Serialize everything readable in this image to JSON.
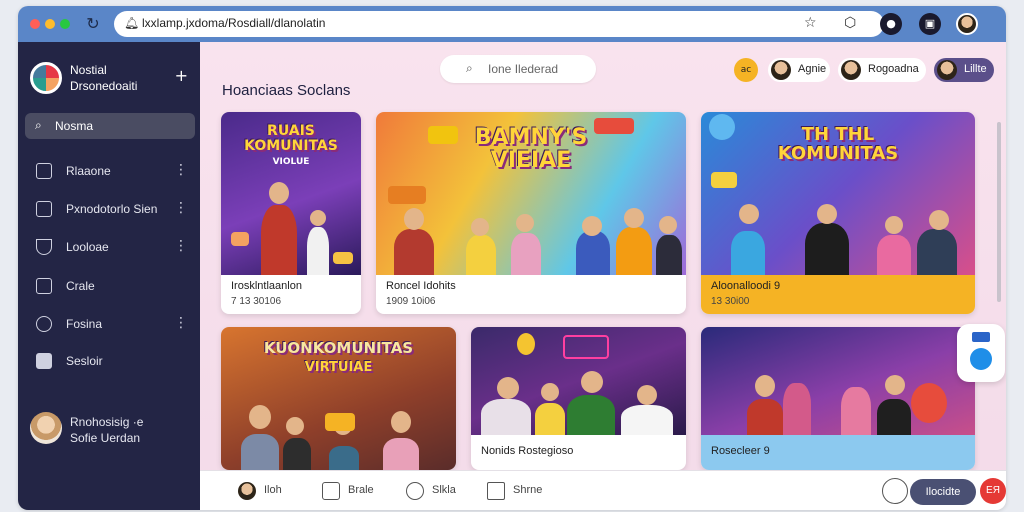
{
  "browser": {
    "url": "lxxlamp.jxdoma/Rosdiall/dlanolatin"
  },
  "sidebar": {
    "brand": {
      "line1": "Nostial",
      "line2": "Drsonedoaiti"
    },
    "search_label": "Nosma",
    "items": [
      {
        "label": "Rlaaone"
      },
      {
        "label": "Pxnodotorlo Sien"
      },
      {
        "label": "Looloae"
      },
      {
        "label": "Crale"
      },
      {
        "label": "Fosina"
      },
      {
        "label": "Sesloir"
      }
    ],
    "profile": {
      "line1": "Rnohosisig ·e",
      "line2": "Sofie Uerdan"
    }
  },
  "header": {
    "search_placeholder": "Ione Ilederad",
    "badge": "ac",
    "users": [
      {
        "label": "Agnie"
      },
      {
        "label": "Rogoadna"
      },
      {
        "label": "Lillte"
      }
    ]
  },
  "main": {
    "title": "Hoanciaas Soclans",
    "cards": [
      {
        "banner": "RUAIS KOMUNITAS",
        "banner_sub": "VIOLUE",
        "title": "Irosklntlaanlon",
        "subtitle": "7 13 30106"
      },
      {
        "banner": "BAMNY'S VIEIAE",
        "banner_sub": "",
        "title": "Roncel Idohits",
        "subtitle": "1909 10i06"
      },
      {
        "banner": "TH THL KOMUNITAS",
        "banner_sub": "",
        "title": "Aloonalloodi 9",
        "subtitle": "13 30i00"
      },
      {
        "banner": "KUONKOMUNITAS",
        "banner_sub": "VIRTUIAE",
        "title": "",
        "subtitle": ""
      },
      {
        "banner": "",
        "banner_sub": "",
        "title": "Nonids Rostegioso",
        "subtitle": ""
      },
      {
        "banner": "",
        "banner_sub": "",
        "title": "Rosecleer 9",
        "subtitle": ""
      }
    ]
  },
  "bottom_bar": {
    "items": [
      {
        "label": "Iloh"
      },
      {
        "label": "Brale"
      },
      {
        "label": "Slkla"
      },
      {
        "label": "Shrne"
      }
    ],
    "pill_label": "Ilocidte",
    "red_label": "ЕЯ"
  }
}
